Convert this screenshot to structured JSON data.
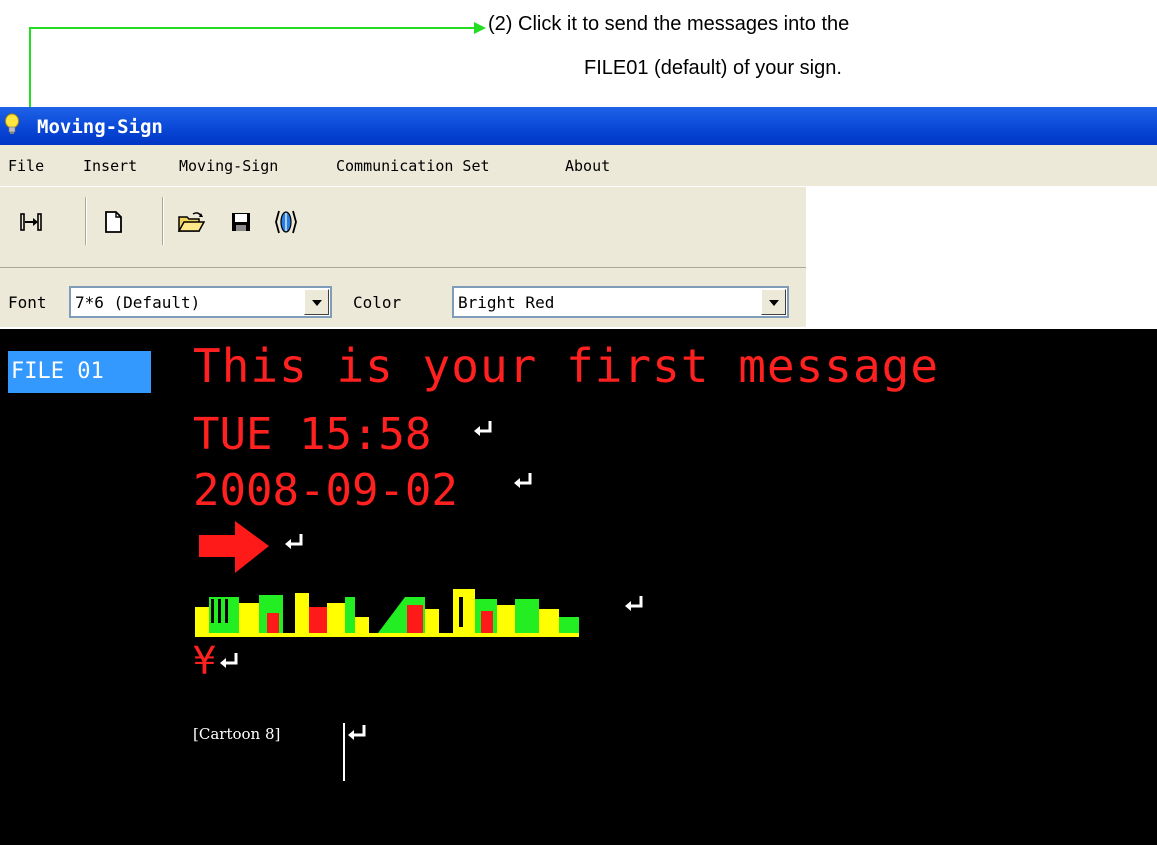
{
  "annotation": {
    "line1": "(2) Click it to send the messages into the",
    "line2": "FILE01 (default) of your sign."
  },
  "window": {
    "title": "Moving-Sign"
  },
  "menu": [
    "File",
    "Insert",
    "Moving-Sign",
    "Communication Set",
    "About"
  ],
  "toolbar": {
    "icons": [
      "send-icon",
      "new-document-icon",
      "open-folder-icon",
      "save-disk-icon",
      "communication-icon"
    ]
  },
  "fontbar": {
    "font_label": "Font",
    "font_value": "7*6 (Default)",
    "color_label": "Color",
    "color_value": "Bright Red"
  },
  "editor": {
    "file_label": "FILE 01",
    "lines": [
      "This is your first message",
      "TUE 15:58",
      "2008-09-02"
    ],
    "yen": "¥",
    "cartoon": "[Cartoon 8]"
  },
  "colors": {
    "accent": "#ff2020",
    "annotation": "#22dd22",
    "selection": "#3399ff"
  }
}
